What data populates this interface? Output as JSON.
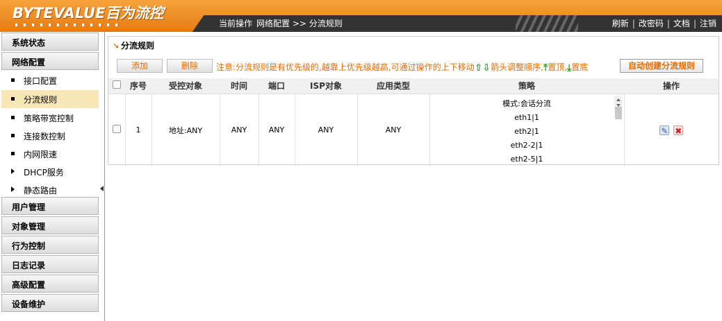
{
  "header": {
    "logo": "BYTEVALUE百为流控",
    "breadcrumb": {
      "label": "当前操作",
      "path": "网络配置 >> 分流规则"
    },
    "links": [
      "刷新",
      "改密码",
      "文档",
      "注销"
    ]
  },
  "sidebar": {
    "sections": [
      {
        "label": "系统状态"
      },
      {
        "label": "网络配置"
      }
    ],
    "sub_items": [
      {
        "label": "接口配置"
      },
      {
        "label": "分流规则"
      },
      {
        "label": "策略带宽控制"
      },
      {
        "label": "连接数控制"
      },
      {
        "label": "内网限速"
      },
      {
        "label": "DHCP服务"
      },
      {
        "label": "静态路由"
      }
    ],
    "sections_after": [
      {
        "label": "用户管理"
      },
      {
        "label": "对象管理"
      },
      {
        "label": "行为控制"
      },
      {
        "label": "日志记录"
      },
      {
        "label": "高级配置"
      },
      {
        "label": "设备维护"
      }
    ]
  },
  "panel": {
    "title": "分流规则",
    "add_label": "添加",
    "delete_label": "删除",
    "note_prefix": "注意:分流规则是有优先级的,越靠上优先级越高,可通过操作的上下移动",
    "note_mid": "箭头调整顺序,",
    "note_top": "置顶,",
    "note_bottom": "置底",
    "auto_label": "自动创建分流规则"
  },
  "table": {
    "columns": [
      "序号",
      "受控对象",
      "时间",
      "端口",
      "ISP对象",
      "应用类型",
      "策略",
      "操作"
    ],
    "rows": [
      {
        "index": "1",
        "target": "地址:ANY",
        "time": "ANY",
        "port": "ANY",
        "isp": "ANY",
        "app": "ANY",
        "policy": [
          "模式:会话分流",
          "eth1|1",
          "eth2|1",
          "eth2-2|1",
          "eth2-5|1"
        ]
      }
    ]
  },
  "colors": {
    "accent": "#e56a00",
    "header_orange": "#f39a2e",
    "header_dark": "#333333",
    "active_item": "#f8e7b6"
  },
  "icons": [
    "edit-icon",
    "delete-icon",
    "arrow-up-icon",
    "arrow-down-icon"
  ]
}
